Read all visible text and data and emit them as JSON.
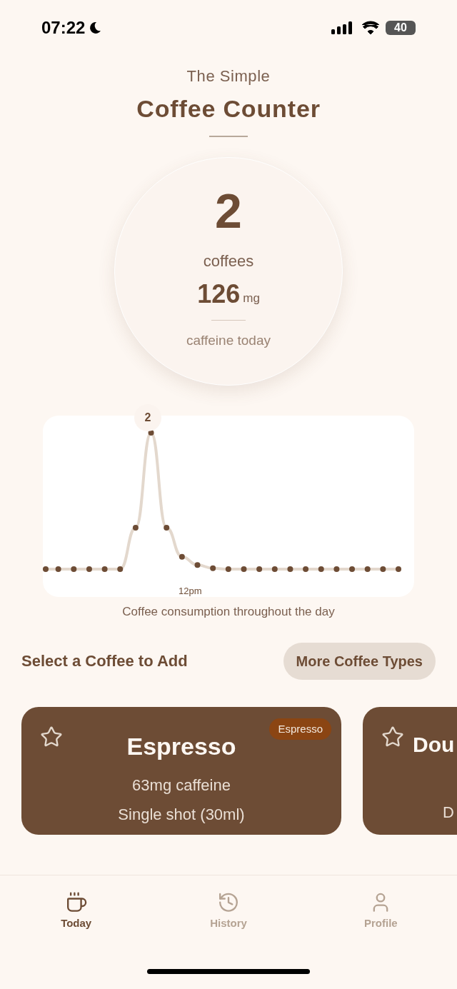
{
  "status_bar": {
    "time": "07:22",
    "battery": "40"
  },
  "header": {
    "subtitle": "The Simple",
    "title": "Coffee Counter"
  },
  "summary": {
    "count": "2",
    "count_label": "coffees",
    "caffeine": "126",
    "unit": "mg",
    "caffeine_label": "caffeine today"
  },
  "chart": {
    "peak_label": "2",
    "x_label": "12pm",
    "caption": "Coffee consumption throughout the day"
  },
  "section": {
    "title": "Select a Coffee to Add",
    "button": "More Coffee Types"
  },
  "coffee_cards": [
    {
      "name": "Espresso",
      "tag": "Espresso",
      "caffeine": "63mg caffeine",
      "serving": "Single shot (30ml)",
      "favorite": false
    },
    {
      "name": "Dou",
      "serving": "D",
      "favorite": false
    }
  ],
  "tabs": [
    {
      "label": "Today",
      "selected": true
    },
    {
      "label": "History",
      "selected": false
    },
    {
      "label": "Profile",
      "selected": false
    }
  ]
}
